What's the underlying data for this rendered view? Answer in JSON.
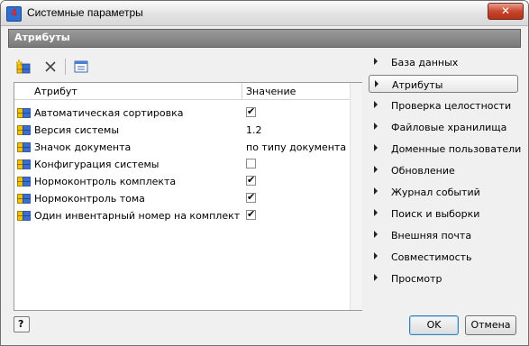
{
  "window": {
    "title": "Системные параметры",
    "close_glyph": "✕"
  },
  "header": {
    "title": "Атрибуты"
  },
  "toolbar": {
    "icons": [
      "new-attribute-icon",
      "delete-icon",
      "properties-icon"
    ]
  },
  "grid": {
    "columns": [
      "Атрибут",
      "Значение"
    ],
    "rows": [
      {
        "name": "Автоматическая сортировка",
        "type": "checkbox",
        "checked": true,
        "value": ""
      },
      {
        "name": "Версия системы",
        "type": "text",
        "checked": false,
        "value": "1.2"
      },
      {
        "name": "Значок документа",
        "type": "text",
        "checked": false,
        "value": "по типу документа"
      },
      {
        "name": "Конфигурация системы",
        "type": "checkbox",
        "checked": false,
        "value": ""
      },
      {
        "name": "Нормоконтроль комплекта",
        "type": "checkbox",
        "checked": true,
        "value": ""
      },
      {
        "name": "Нормоконтроль тома",
        "type": "checkbox",
        "checked": true,
        "value": ""
      },
      {
        "name": "Один инвентарный номер на комплект",
        "type": "checkbox",
        "checked": true,
        "value": ""
      }
    ]
  },
  "nav": {
    "selected_index": 1,
    "items": [
      "База данных",
      "Атрибуты",
      "Проверка целостности",
      "Файловые хранилища",
      "Доменные пользователи",
      "Обновление",
      "Журнал событий",
      "Поиск и выборки",
      "Внешняя почта",
      "Совместимость",
      "Просмотр"
    ]
  },
  "footer": {
    "ok_label": "OK",
    "cancel_label": "Отмена"
  },
  "colors": {
    "header_bar": "#8a8a8a",
    "close_button": "#c8462e",
    "attr_icon_yellow": "#f2c200",
    "attr_icon_blue": "#3a6fd0"
  }
}
